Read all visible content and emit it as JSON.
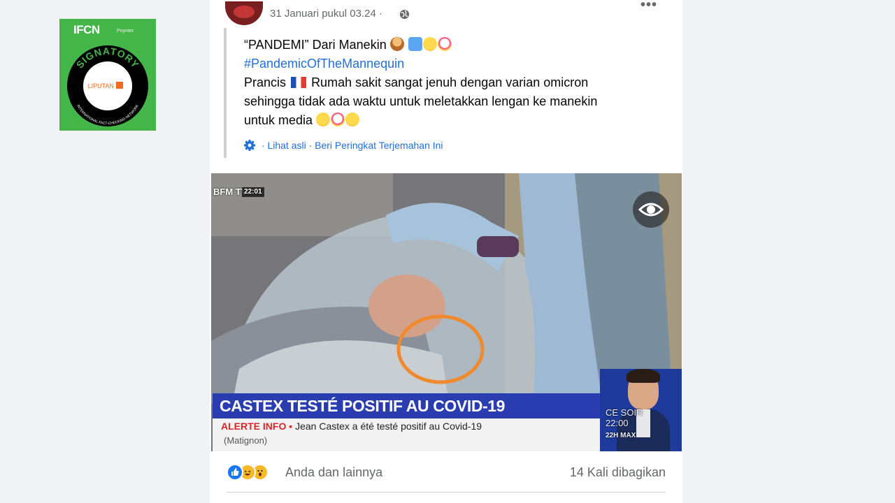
{
  "badge": {
    "ifcn": "IFCN",
    "poynter": "Poynter.",
    "signatory": "SIGNATORY",
    "member": "LIPUTAN 6",
    "ring_text": "INTERNATIONAL FACT-CHECKING NETWORK"
  },
  "post": {
    "timestamp": "31 Januari pukul 03.24 ·",
    "text": {
      "line1": "“PANDEMI” Dari Manekin",
      "hashtag": "#PandemicOfTheMannequin",
      "line3a": "Prancis",
      "line3b": "Rumah sakit sangat jenuh dengan varian omicron",
      "line4": "sehingga tidak ada waktu untuk meletakkan lengan ke manekin",
      "line5": "untuk media"
    },
    "translate": {
      "see_original": "· Lihat asli",
      "rate": "· Beri Peringkat Terjemahan Ini"
    },
    "image": {
      "channel": "BFM TV",
      "time": "22:01",
      "headline": "CASTEX TESTÉ POSITIF AU COVID-19",
      "alert_label": "ALERTE INFO",
      "alert_text": "Jean Castex a été testé positif au Covid-19",
      "location": "(Matignon)",
      "ce_soir": "CE SOIR",
      "ce_time": "22:00",
      "show": "22H MAX"
    },
    "reactions_text": "Anda dan lainnya",
    "shares": "14 Kali dibagikan"
  },
  "colors": {
    "link": "#216fdb",
    "badge_green": "#44b649",
    "banner_blue": "#2a3db0",
    "alert_red": "#d8262a"
  }
}
